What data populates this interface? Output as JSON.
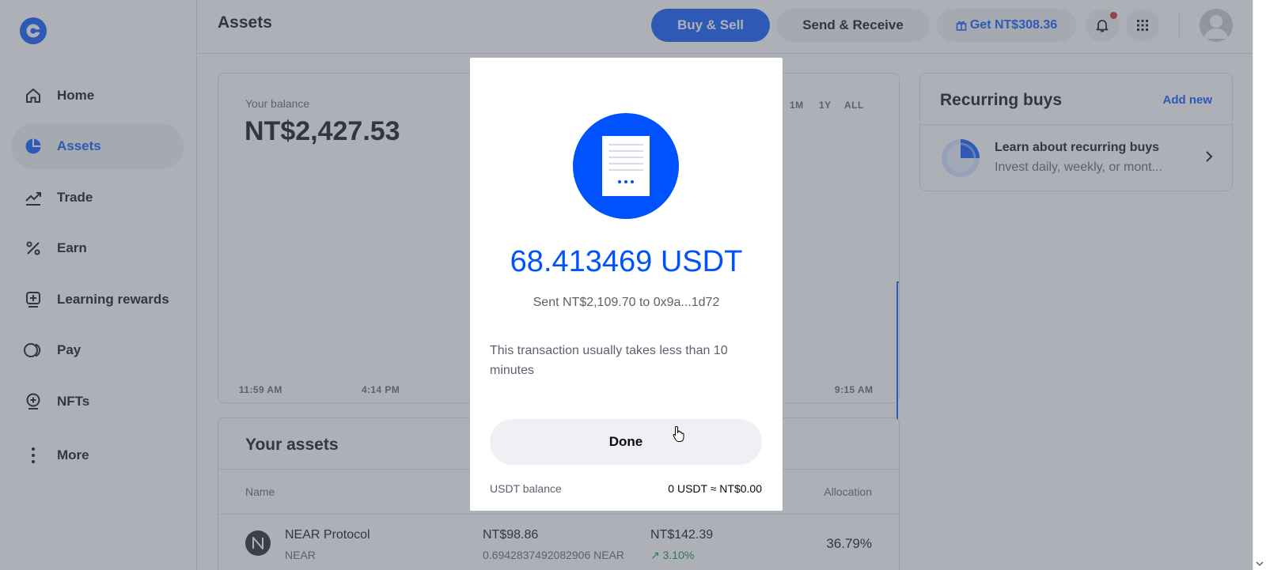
{
  "sidebar": {
    "items": [
      {
        "label": "Home",
        "icon": "home-icon"
      },
      {
        "label": "Assets",
        "icon": "pie-chart-icon",
        "active": true
      },
      {
        "label": "Trade",
        "icon": "trend-chart-icon"
      },
      {
        "label": "Earn",
        "icon": "percent-icon"
      },
      {
        "label": "Learning rewards",
        "icon": "learning-rewards-icon"
      },
      {
        "label": "Pay",
        "icon": "pay-icon"
      },
      {
        "label": "NFTs",
        "icon": "nft-icon"
      },
      {
        "label": "More",
        "icon": "more-vertical-icon"
      }
    ]
  },
  "header": {
    "title": "Assets",
    "buy_sell_label": "Buy & Sell",
    "send_receive_label": "Send & Receive",
    "get_reward_label": "Get NT$308.36"
  },
  "balance": {
    "label": "Your balance",
    "value": "NT$2,427.53",
    "ranges": [
      "1M",
      "1Y",
      "ALL"
    ],
    "time_labels": [
      "11:59 AM",
      "4:14 PM",
      "9:15 AM"
    ]
  },
  "assets": {
    "title": "Your assets",
    "columns": {
      "name": "Name",
      "allocation": "Allocation"
    },
    "rows": [
      {
        "name": "NEAR Protocol",
        "symbol": "NEAR",
        "balance": "NT$98.86",
        "balance_crypto": "0.6942837492082906 NEAR",
        "price": "NT$142.39",
        "change": "↗ 3.10%",
        "allocation": "36.79%"
      }
    ]
  },
  "recurring": {
    "title": "Recurring buys",
    "add_label": "Add new",
    "item_title": "Learn about recurring buys",
    "item_subtitle": "Invest daily, weekly, or mont..."
  },
  "modal": {
    "amount": "68.413469 USDT",
    "sent_text": "Sent NT$2,109.70 to 0x9a...1d72",
    "info_text": "This transaction usually takes less than 10 minutes",
    "done_label": "Done",
    "balance_label": "USDT balance",
    "balance_value": "0 USDT ≈ NT$0.00"
  },
  "colors": {
    "brand_blue": "#0052ff",
    "positive_green": "#098551",
    "overlay": "rgba(91,97,110,0.5)"
  }
}
